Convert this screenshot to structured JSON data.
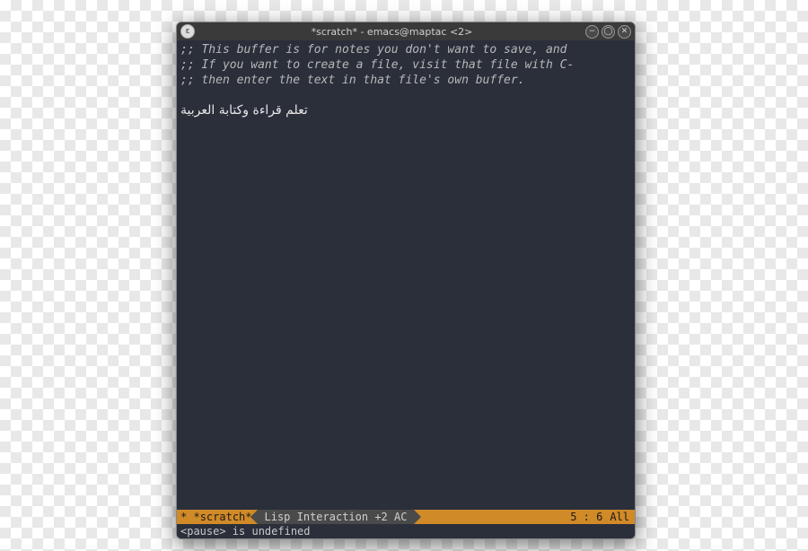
{
  "titlebar": {
    "title": "*scratch* - emacs@maptac <2>",
    "appicon": "emacs-icon",
    "buttons": {
      "minimize": "−",
      "maximize": "◯",
      "close": "✕"
    }
  },
  "editor": {
    "comment_line1": ";; This buffer is for notes you don't want to save, and ",
    "comment_line2": ";; If you want to create a file, visit that file with C-",
    "comment_line3": ";; then enter the text in that file's own buffer.",
    "arabic_text": "تعلم قراءة وكتابة العربية"
  },
  "modeline": {
    "modified": "*",
    "buffer": "*scratch*",
    "mode": "Lisp Interaction +2 AC",
    "position": "5 : 6",
    "scroll": "All"
  },
  "echo": "<pause> is undefined"
}
